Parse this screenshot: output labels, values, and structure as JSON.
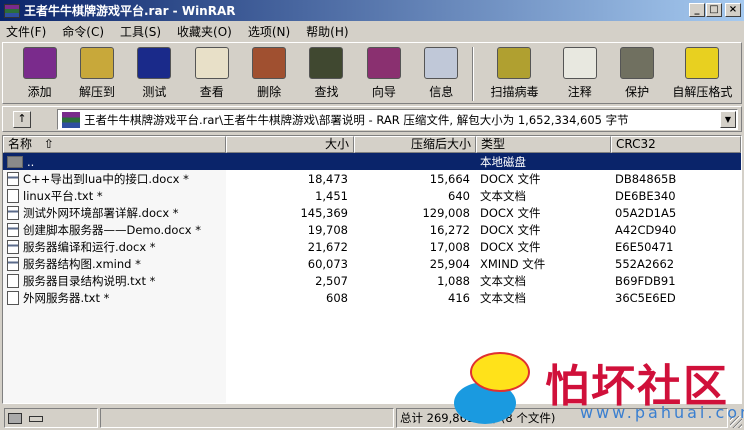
{
  "window": {
    "title": "王者牛牛棋牌游戏平台.rar - WinRAR",
    "minimize": "_",
    "maximize": "□",
    "close": "×"
  },
  "menu": [
    "文件(F)",
    "命令(C)",
    "工具(S)",
    "收藏夹(O)",
    "选项(N)",
    "帮助(H)"
  ],
  "toolbar": [
    {
      "label": "添加",
      "icon": "add-archive-icon",
      "color": "#7a2b8c"
    },
    {
      "label": "解压到",
      "icon": "extract-icon",
      "color": "#c8a83a"
    },
    {
      "label": "测试",
      "icon": "test-icon",
      "color": "#1a2a8a"
    },
    {
      "label": "查看",
      "icon": "view-icon",
      "color": "#e8e0c8"
    },
    {
      "label": "删除",
      "icon": "delete-icon",
      "color": "#a05030"
    },
    {
      "label": "查找",
      "icon": "find-icon",
      "color": "#404830"
    },
    {
      "label": "向导",
      "icon": "wizard-icon",
      "color": "#8a3070"
    },
    {
      "label": "信息",
      "icon": "info-icon",
      "color": "#c0c8d8"
    },
    {
      "label": "扫描病毒",
      "icon": "virus-scan-icon",
      "color": "#b0a030"
    },
    {
      "label": "注释",
      "icon": "comment-icon",
      "color": "#e8e8e0"
    },
    {
      "label": "保护",
      "icon": "protect-icon",
      "color": "#707060"
    },
    {
      "label": "自解压格式",
      "icon": "sfx-icon",
      "color": "#e8d020"
    }
  ],
  "address": {
    "path": "王者牛牛棋牌游戏平台.rar\\王者牛牛棋牌游戏\\部署说明 - RAR 压缩文件, 解包大小为 1,652,334,605 字节",
    "up": "↑",
    "dropdown": "▼"
  },
  "columns": {
    "name": "名称",
    "sort": "⇧",
    "size": "大小",
    "packed": "压缩后大小",
    "type": "类型",
    "crc": "CRC32"
  },
  "parent_row": {
    "name": "..",
    "type": "本地磁盘"
  },
  "files": [
    {
      "name": "C++导出到lua中的接口.docx *",
      "size": "18,473",
      "packed": "15,664",
      "type": "DOCX 文件",
      "crc": "DB84865B",
      "kind": "doc"
    },
    {
      "name": "linux平台.txt *",
      "size": "1,451",
      "packed": "640",
      "type": "文本文档",
      "crc": "DE6BE340",
      "kind": "txt"
    },
    {
      "name": "测试外网环境部署详解.docx *",
      "size": "145,369",
      "packed": "129,008",
      "type": "DOCX 文件",
      "crc": "05A2D1A5",
      "kind": "doc"
    },
    {
      "name": "创建脚本服务器——Demo.docx *",
      "size": "19,708",
      "packed": "16,272",
      "type": "DOCX 文件",
      "crc": "A42CD940",
      "kind": "doc"
    },
    {
      "name": "服务器编译和运行.docx *",
      "size": "21,672",
      "packed": "17,008",
      "type": "DOCX 文件",
      "crc": "E6E50471",
      "kind": "doc"
    },
    {
      "name": "服务器结构图.xmind *",
      "size": "60,073",
      "packed": "25,904",
      "type": "XMIND 文件",
      "crc": "552A2662",
      "kind": "doc"
    },
    {
      "name": "服务器目录结构说明.txt *",
      "size": "2,507",
      "packed": "1,088",
      "type": "文本文档",
      "crc": "B69FDB91",
      "kind": "txt"
    },
    {
      "name": "外网服务器.txt *",
      "size": "608",
      "packed": "416",
      "type": "文本文档",
      "crc": "36C5E6ED",
      "kind": "txt"
    }
  ],
  "status": {
    "total": "总计 269,861 字节(8 个文件)"
  },
  "watermark": {
    "name": "怕坏社区",
    "url": "www.pahuai.com"
  }
}
